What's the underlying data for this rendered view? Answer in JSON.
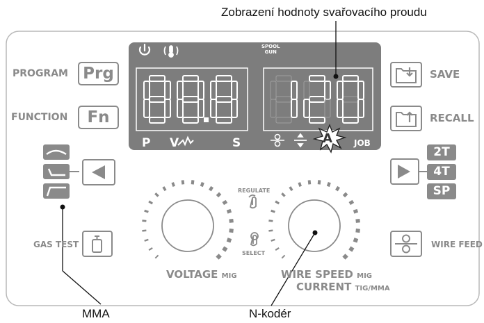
{
  "callouts": {
    "top": "Zobrazení hodnoty svařovacího proudu",
    "left_bottom": "MMA",
    "center_bottom": "N-kodér"
  },
  "left_panel": {
    "program_label": "PROGRAM",
    "program_key": "Prg",
    "function_label": "FUNCTION",
    "function_key": "Fn",
    "gas_test_label": "GAS TEST"
  },
  "right_panel": {
    "save_label": "SAVE",
    "recall_label": "RECALL",
    "mode_2t": "2T",
    "mode_4t": "4T",
    "mode_sp": "SP",
    "wire_feed_label": "WIRE FEED"
  },
  "display": {
    "spool_gun_line1": "SPOOL",
    "spool_gun_line2": "GUN",
    "left_value": "88.8",
    "right_value": "120",
    "ind_p": "P",
    "ind_v": "V",
    "ind_s": "S",
    "ind_a": "A",
    "ind_job": "JOB"
  },
  "knobs": {
    "regulate_label": "REGULATE",
    "select_label": "SELECT",
    "voltage_label": "VOLTAGE",
    "voltage_sub": "MIG",
    "wire_speed_label": "WIRE SPEED",
    "wire_speed_sub": "MIG",
    "current_label": "CURRENT",
    "current_sub": "TIG/MMA"
  },
  "colors": {
    "panel_gray": "#8a8a8a",
    "display_bg": "#7d7d7d",
    "frame": "#b5b5b5"
  }
}
